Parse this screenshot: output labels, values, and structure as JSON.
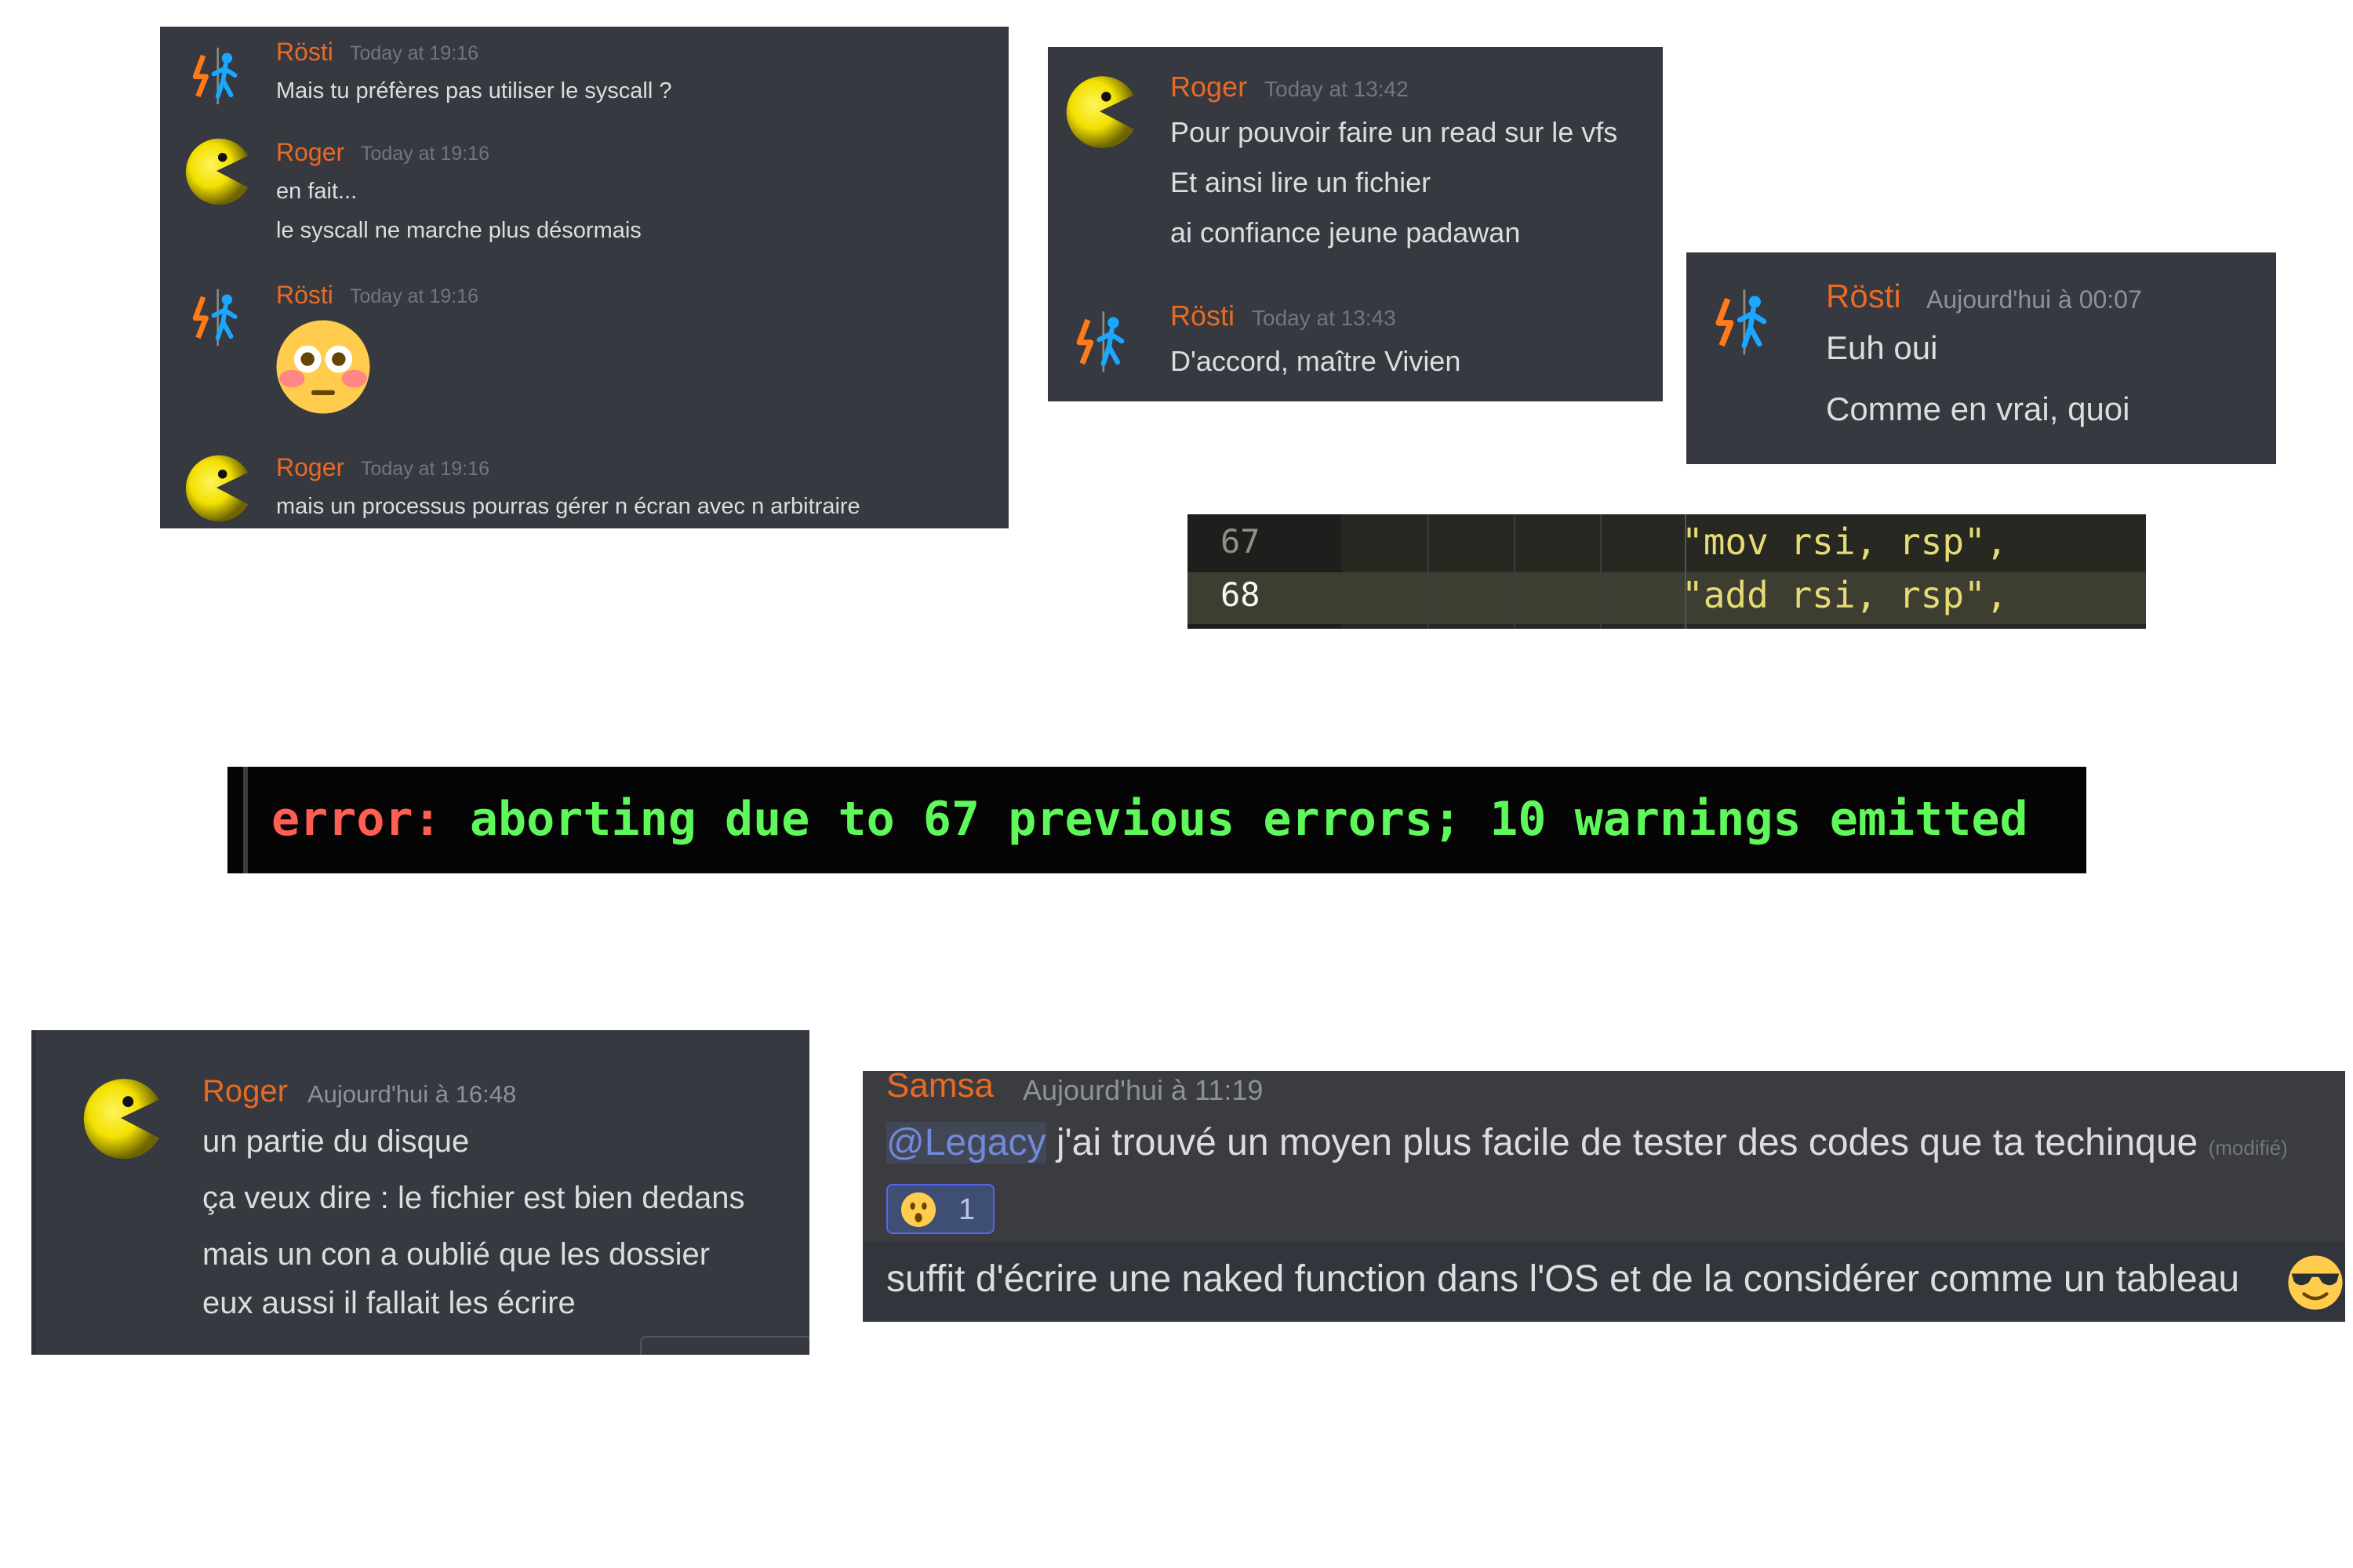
{
  "colors": {
    "panel_bg": "#36393f",
    "author_orange": "#e86a24",
    "timestamp": "#72767d",
    "text": "#dcddde",
    "mention": "#7289da",
    "error_red": "#ff5f52",
    "error_green": "#5ef85a",
    "code_string": "#e6db74"
  },
  "panel1": {
    "messages": [
      {
        "author": "Rösti",
        "timestamp": "Today at 19:16",
        "lines": [
          "Mais tu préfères pas utiliser le syscall ?"
        ]
      },
      {
        "author": "Roger",
        "timestamp": "Today at 19:16",
        "lines": [
          "en fait...",
          "le syscall ne marche plus désormais"
        ]
      },
      {
        "author": "Rösti",
        "timestamp": "Today at 19:16",
        "emoji": "flushed-face"
      },
      {
        "author": "Roger",
        "timestamp": "Today at 19:16",
        "lines": [
          "mais un processus pourras gérer n écran avec n arbitraire"
        ]
      }
    ]
  },
  "panel2": {
    "messages": [
      {
        "author": "Roger",
        "timestamp": "Today at 13:42",
        "lines": [
          "Pour pouvoir faire un read sur le vfs",
          "Et ainsi lire un fichier",
          "ai confiance jeune padawan"
        ]
      },
      {
        "author": "Rösti",
        "timestamp": "Today at 13:43",
        "lines": [
          "D'accord, maître Vivien"
        ]
      }
    ]
  },
  "panel3": {
    "messages": [
      {
        "author": "Rösti",
        "timestamp": "Aujourd'hui à 00:07",
        "lines": [
          "Euh oui",
          "Comme en vrai, quoi"
        ]
      }
    ]
  },
  "code": {
    "lines": [
      {
        "number": "67",
        "text": "\"mov rsi, rsp\","
      },
      {
        "number": "68",
        "text": "\"add rsi, rsp\","
      }
    ]
  },
  "error": {
    "prefix": "error:",
    "message": " aborting due to 67 previous errors; 10 warnings emitted"
  },
  "panel4": {
    "messages": [
      {
        "author": "Roger",
        "timestamp": "Aujourd'hui à 16:48",
        "lines": [
          "un partie du disque",
          "ça veux dire : le fichier est bien dedans",
          "mais un con a oublié que les dossier",
          "eux aussi il fallait les écrire"
        ]
      }
    ]
  },
  "panel5": {
    "author": "Samsa",
    "timestamp": "Aujourd'hui à 11:19",
    "mention": "@Legacy",
    "line1": " j'ai trouvé un moyen plus facile de tester des codes que ta techinque",
    "edited": "(modifié)",
    "reaction": {
      "emoji": "hushed-face",
      "count": "1"
    },
    "line2": "suffit d'écrire une naked function dans l'OS et de la considérer comme un tableau",
    "trailing_emoji": "sunglasses-face"
  },
  "icons": {
    "rosti_avatar": "portal-figure-icon",
    "roger_avatar": "pacman-icon"
  }
}
